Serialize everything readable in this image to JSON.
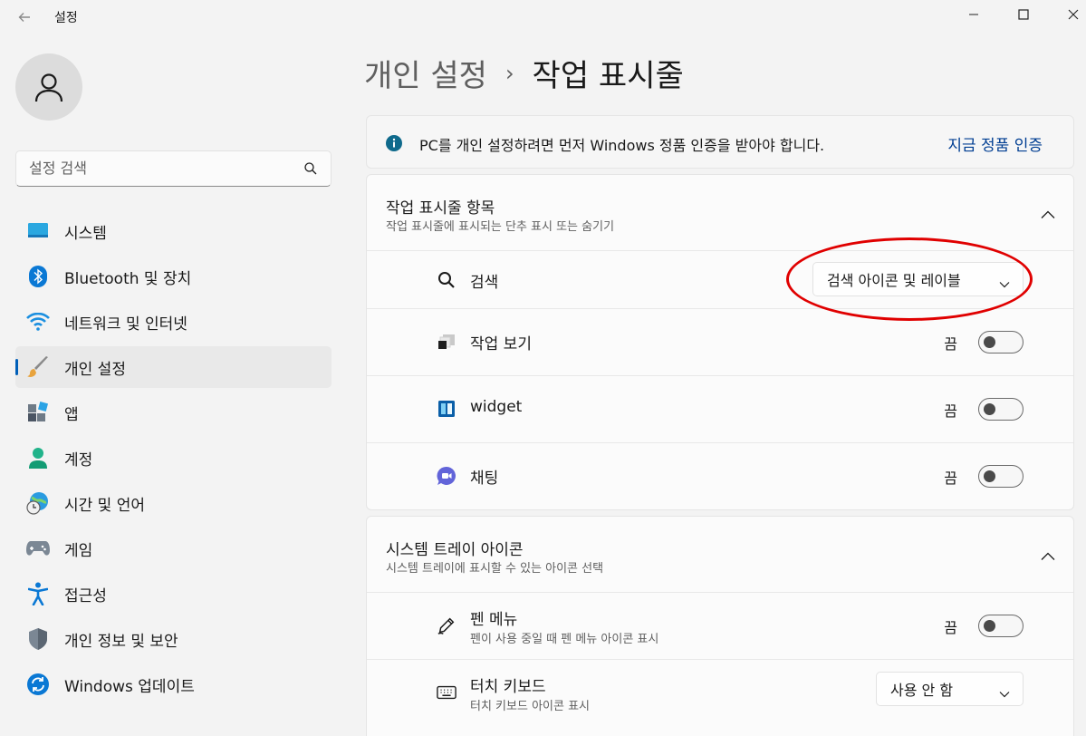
{
  "window": {
    "title": "설정",
    "back_icon": "arrow-left-icon",
    "minimize_icon": "minimize-icon",
    "maximize_icon": "maximize-icon"
  },
  "sidebar": {
    "avatar_icon": "user-icon",
    "search": {
      "placeholder": "설정 검색"
    },
    "items": [
      {
        "label": "시스템",
        "icon": "monitor-icon",
        "active": false
      },
      {
        "label": "Bluetooth 및 장치",
        "icon": "bluetooth-icon",
        "active": false
      },
      {
        "label": "네트워크 및 인터넷",
        "icon": "wifi-icon",
        "active": false
      },
      {
        "label": "개인 설정",
        "icon": "paintbrush-icon",
        "active": true
      },
      {
        "label": "앱",
        "icon": "apps-icon",
        "active": false
      },
      {
        "label": "계정",
        "icon": "account-icon",
        "active": false
      },
      {
        "label": "시간 및 언어",
        "icon": "globe-clock-icon",
        "active": false
      },
      {
        "label": "게임",
        "icon": "gamepad-icon",
        "active": false
      },
      {
        "label": "접근성",
        "icon": "accessibility-icon",
        "active": false
      },
      {
        "label": "개인 정보 및 보안",
        "icon": "shield-icon",
        "active": false
      },
      {
        "label": "Windows 업데이트",
        "icon": "update-icon",
        "active": false
      }
    ]
  },
  "breadcrumb": {
    "parent": "개인 설정",
    "separator": "›",
    "current": "작업 표시줄"
  },
  "activation": {
    "message": "PC를 개인 설정하려면 먼저 Windows 정품 인증을 받아야 합니다.",
    "link": "지금 정품 인증"
  },
  "taskbar_items": {
    "title": "작업 표시줄 항목",
    "subtitle": "작업 표시줄에 표시되는 단추 표시 또는 숨기기",
    "rows": [
      {
        "label": "검색",
        "icon": "search-icon",
        "control": "dropdown",
        "value": "검색 아이콘 및 레이블"
      },
      {
        "label": "작업 보기",
        "icon": "task-view-icon",
        "control": "toggle",
        "state_text": "끔",
        "on": false
      },
      {
        "label": "widget",
        "icon": "widgets-icon",
        "control": "toggle",
        "state_text": "끔",
        "on": false
      },
      {
        "label": "채팅",
        "icon": "chat-icon",
        "control": "toggle",
        "state_text": "끔",
        "on": false
      }
    ]
  },
  "tray_icons": {
    "title": "시스템 트레이 아이콘",
    "subtitle": "시스템 트레이에 표시할 수 있는 아이콘 선택",
    "rows": [
      {
        "label": "펜 메뉴",
        "sub": "펜이 사용 중일 때 펜 메뉴 아이콘 표시",
        "icon": "pen-icon",
        "control": "toggle",
        "state_text": "끔",
        "on": false
      },
      {
        "label": "터치 키보드",
        "sub": "터치 키보드 아이콘 표시",
        "icon": "keyboard-icon",
        "control": "dropdown",
        "value": "사용 안 함"
      }
    ]
  },
  "colors": {
    "accent": "#005fb8",
    "link": "#003e92",
    "annotation": "#e00000",
    "background": "#f3f3f3"
  }
}
